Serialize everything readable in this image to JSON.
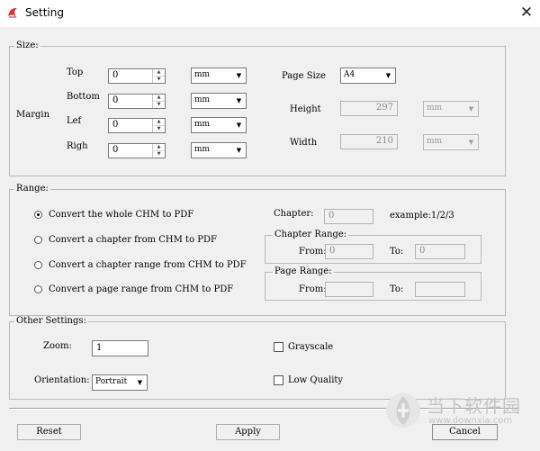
{
  "window": {
    "title": "Setting"
  },
  "size": {
    "title": "Size:",
    "margin_label": "Margin",
    "top": {
      "label": "Top",
      "value": "0",
      "unit": "mm"
    },
    "bottom": {
      "label": "Bottom",
      "value": "0",
      "unit": "mm"
    },
    "left": {
      "label": "Lef",
      "value": "0",
      "unit": "mm"
    },
    "right": {
      "label": "Righ",
      "value": "0",
      "unit": "mm"
    },
    "page_size": {
      "label": "Page Size",
      "value": "A4"
    },
    "height": {
      "label": "Height",
      "value": "297",
      "unit": "mm"
    },
    "width": {
      "label": "Width",
      "value": "210",
      "unit": "mm"
    }
  },
  "range": {
    "title": "Range:",
    "options": [
      "Convert the whole CHM to PDF",
      "Convert a chapter from CHM to PDF",
      "Convert a chapter range from CHM to PDF",
      "Convert a page range from CHM to PDF"
    ],
    "selected_index": 0,
    "chapter": {
      "label": "Chapter:",
      "value": "0",
      "example": "example:1/2/3"
    },
    "chapter_range": {
      "title": "Chapter Range:",
      "from_label": "From:",
      "from_value": "0",
      "to_label": "To:",
      "to_value": "0"
    },
    "page_range": {
      "title": "Page Range:",
      "from_label": "From:",
      "from_value": "",
      "to_label": "To:",
      "to_value": ""
    }
  },
  "other": {
    "title": "Other Settings:",
    "zoom": {
      "label": "Zoom:",
      "value": "1"
    },
    "orientation": {
      "label": "Orientation:",
      "value": "Portrait"
    },
    "grayscale": {
      "label": "Grayscale",
      "checked": false
    },
    "low_quality": {
      "label": "Low Quality",
      "checked": false
    }
  },
  "buttons": {
    "reset": "Reset",
    "apply": "Apply",
    "cancel": "Cancel"
  },
  "watermark": {
    "brand": "当下软件园",
    "url": "www.downxia.com"
  }
}
